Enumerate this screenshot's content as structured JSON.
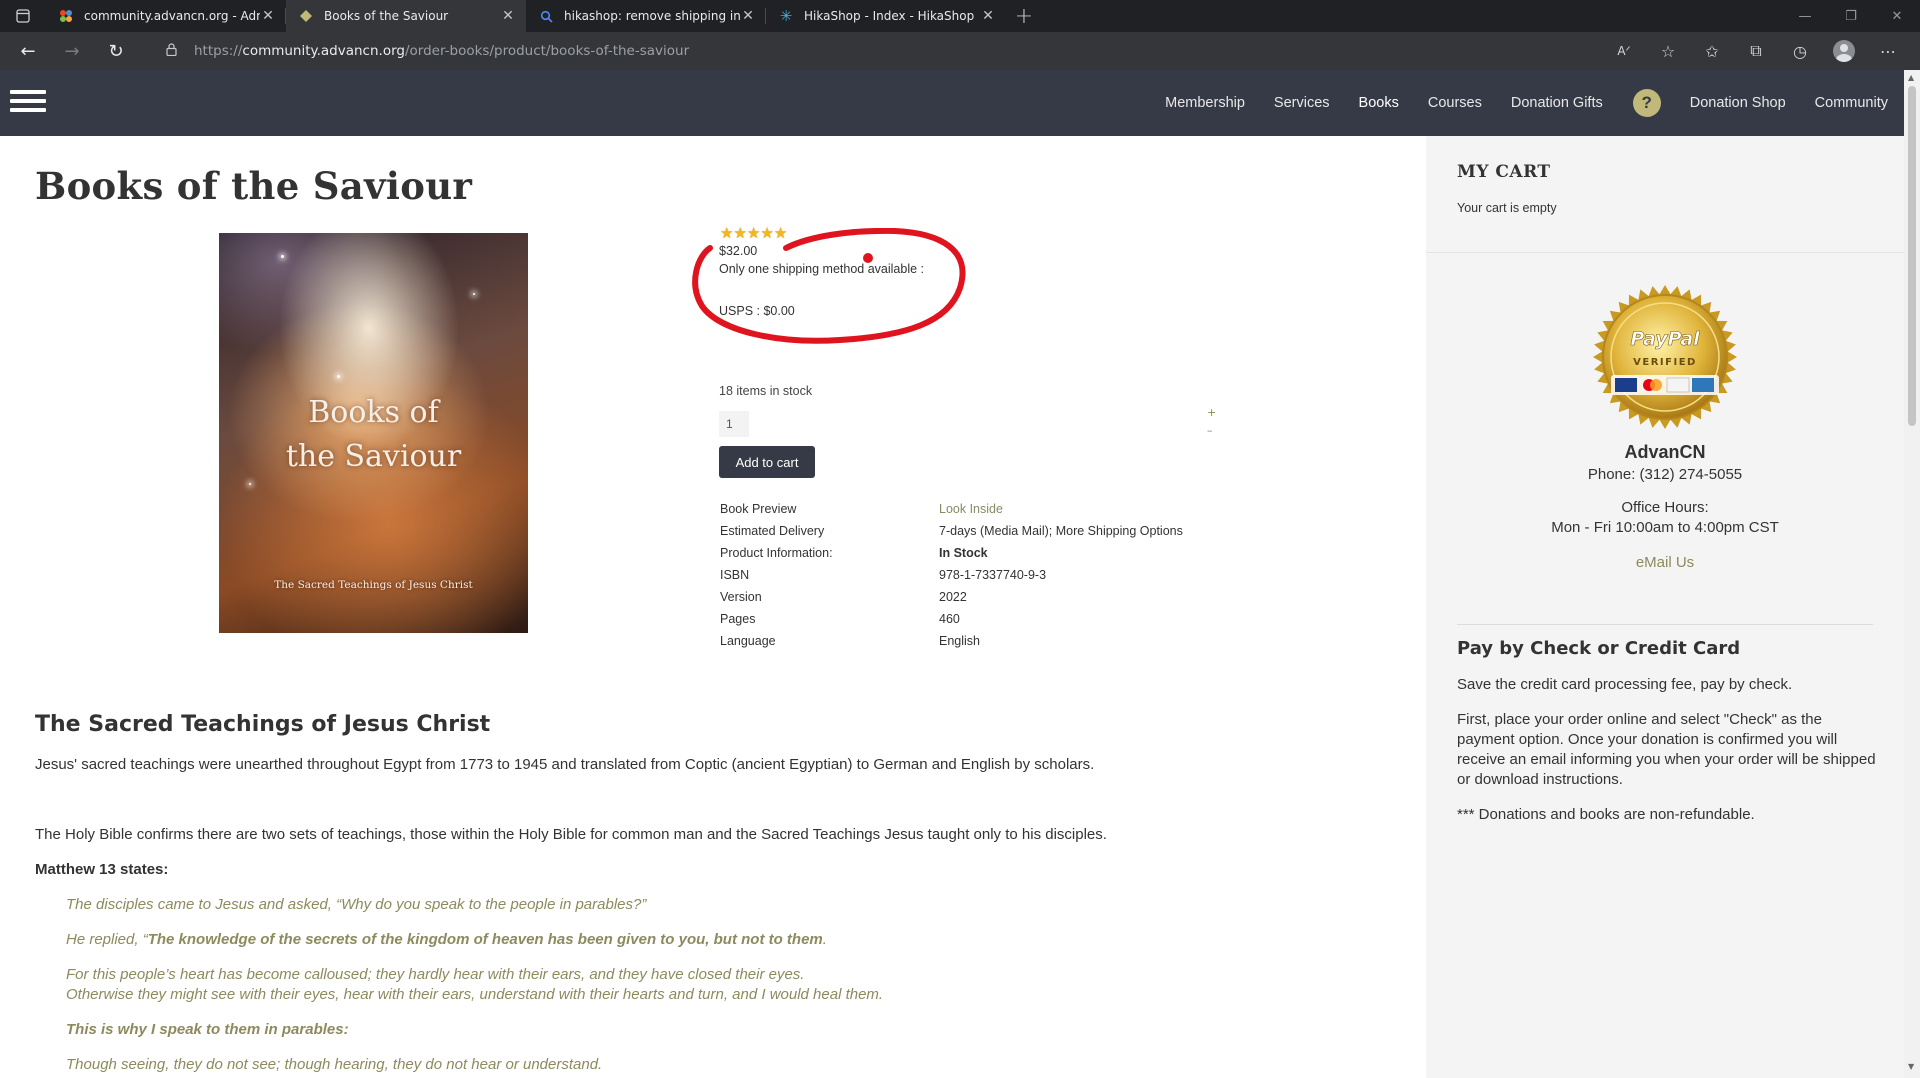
{
  "browser": {
    "tabs": [
      {
        "title": "community.advancn.org - Admin",
        "icon": "joomla-icon",
        "active": false
      },
      {
        "title": "Books of the Saviour",
        "icon": "site-favicon",
        "active": true
      },
      {
        "title": "hikashop: remove shipping infor",
        "icon": "search-icon",
        "active": false
      },
      {
        "title": "HikaShop - Index - HikaShop",
        "icon": "hikashop-icon",
        "active": false
      }
    ],
    "url_scheme": "https://",
    "url_host": "community.advancn.org",
    "url_path": "/order-books/product/books-of-the-saviour"
  },
  "nav": {
    "items": [
      "Membership",
      "Services",
      "Books",
      "Courses",
      "Donation Gifts"
    ],
    "help_label": "?",
    "items_right": [
      "Donation Shop",
      "Community"
    ],
    "active": "Books"
  },
  "product": {
    "title": "Books of the Saviour",
    "cover_title_line1": "Books of",
    "cover_title_line2": "the Saviour",
    "cover_subtitle": "The Sacred Teachings of Jesus Christ",
    "rating": 5,
    "rating_max": 5,
    "price": "$32.00",
    "shipping_note": "Only one shipping method available :",
    "shipping_method": "USPS : $0.00",
    "stock": "18 items in stock",
    "quantity": "1",
    "qty_plus": "+",
    "qty_minus": "–",
    "add_to_cart": "Add to cart",
    "specs": [
      {
        "label": "Book Preview",
        "value": "Look Inside"
      },
      {
        "label": "Estimated Delivery",
        "value": "7-days (Media Mail); More Shipping Options"
      },
      {
        "label": "Product Information:",
        "value": "In Stock"
      },
      {
        "label": "ISBN",
        "value": "978-1-7337740-9-3"
      },
      {
        "label": "Version",
        "value": "2022"
      },
      {
        "label": "Pages",
        "value": "460"
      },
      {
        "label": "Language",
        "value": "English"
      }
    ]
  },
  "description": {
    "heading": "The Sacred Teachings of Jesus Christ",
    "p1": "Jesus' sacred teachings were unearthed throughout Egypt from 1773 to 1945 and translated from Coptic (ancient Egyptian) to German and English by scholars.",
    "p2": "The Holy Bible confirms there are two sets of teachings, those within the Holy Bible for common man and the Sacred Teachings Jesus taught only to his disciples.",
    "p3": "Matthew 13 states:",
    "q1": "The disciples came to Jesus and asked, “Why do you speak to the people in parables?”",
    "q2_prefix": "He replied, “",
    "q2_bold": "The knowledge of the secrets of the kingdom of heaven has been given to you, but not to them",
    "q2_suffix": ".",
    "q3": "For this people’s heart has become calloused; they hardly hear with their ears, and they have closed their eyes.",
    "q4": "Otherwise they might see with their eyes, hear with their ears, understand with their hearts and turn, and I would heal them.",
    "q5": "This is why I speak to them in parables:",
    "q6": "Though seeing, they do not see; though hearing, they do not hear or understand."
  },
  "sidebar": {
    "cart_title": "MY CART",
    "cart_empty": "Your cart is empty",
    "seal_text1": "PayPal",
    "seal_text2": "VERIFIED",
    "org_name": "AdvanCN",
    "phone": "Phone: (312) 274-5055",
    "hours_title": "Office Hours:",
    "hours": "Mon - Fri 10:00am to 4:00pm CST",
    "email_link": "eMail Us",
    "pay_title": "Pay by Check or Credit Card",
    "pay_p1": "Save the credit card processing fee, pay by check.",
    "pay_p2": "First, place your order online and select \"Check\" as the payment option. Once your donation is confirmed you will receive an email informing you when your order will be shipped or download instructions.",
    "pay_p3": "*** Donations and books are non-refundable."
  },
  "colors": {
    "nav_bg": "#363a46",
    "accent_olive": "#8d8a5e",
    "annotation_red": "#e0141e",
    "star_gold": "#f2b81b"
  }
}
